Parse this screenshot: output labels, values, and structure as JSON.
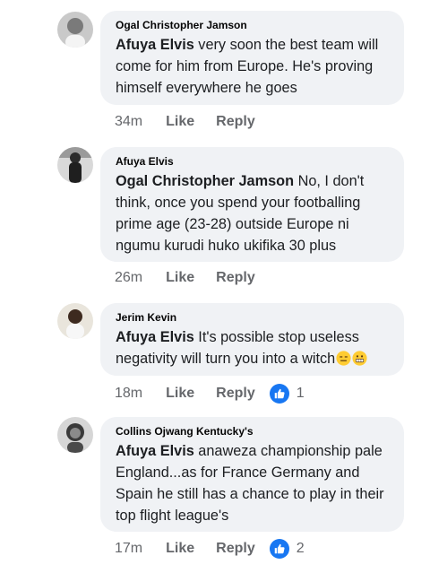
{
  "comments": [
    {
      "author": "Ogal Christopher Jamson",
      "mention": "Afuya Elvis",
      "text": " very soon the best team will come for him from Europe. He's proving himself everywhere he goes",
      "time": "34m",
      "like_label": "Like",
      "reply_label": "Reply"
    },
    {
      "author": "Afuya Elvis",
      "mention": "Ogal Christopher Jamson",
      "text": " No, I don't think, once you spend  your footballing prime age (23-28) outside Europe ni ngumu kurudi huko ukifika 30 plus",
      "time": "26m",
      "like_label": "Like",
      "reply_label": "Reply"
    },
    {
      "author": "Jerim Kevin",
      "mention": "Afuya Elvis",
      "text": " It's possible stop useless negativity will turn you into a witch",
      "emojis": [
        "expressionless-face-icon",
        "grimacing-face-icon"
      ],
      "time": "18m",
      "like_label": "Like",
      "reply_label": "Reply",
      "reaction_count": "1"
    },
    {
      "author": "Collins Ojwang Kentucky's",
      "mention": "Afuya Elvis",
      "text": " anaweza championship pale England...as for France Germany and Spain he still has a chance to play in their top flight league's",
      "time": "17m",
      "like_label": "Like",
      "reply_label": "Reply",
      "reaction_count": "2"
    }
  ],
  "colors": {
    "bubble": "#f0f2f5",
    "meta": "#65676b",
    "like_badge": "#1877f2"
  }
}
